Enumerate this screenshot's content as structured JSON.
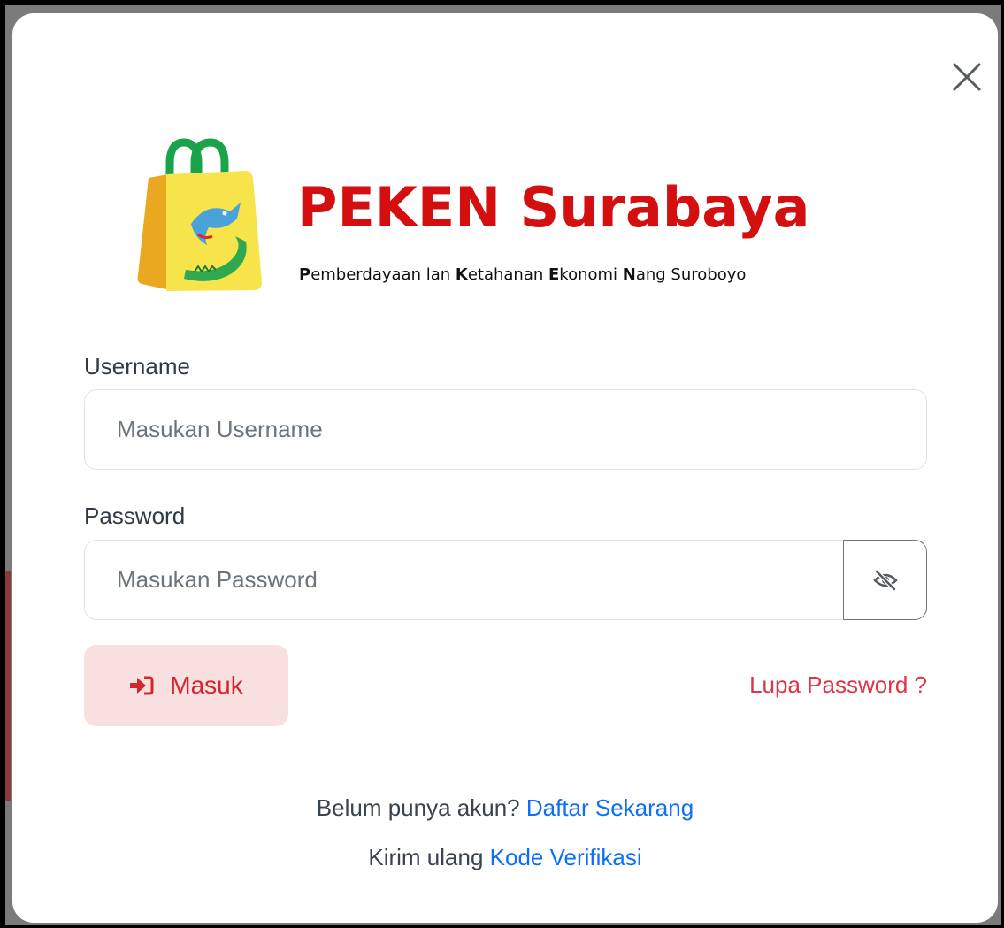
{
  "brand": {
    "title": "PEKEN Surabaya",
    "tagline_parts": [
      {
        "bold": "P",
        "rest": "emberdayaan lan "
      },
      {
        "bold": "K",
        "rest": "etahanan "
      },
      {
        "bold": "E",
        "rest": "konomi "
      },
      {
        "bold": "N",
        "rest": "ang Suroboyo"
      }
    ],
    "title_color": "#d30f0f"
  },
  "form": {
    "username_label": "Username",
    "username_placeholder": "Masukan Username",
    "username_value": "",
    "password_label": "Password",
    "password_placeholder": "Masukan Password",
    "password_value": "",
    "toggle_icon": "eye-slash-icon"
  },
  "actions": {
    "login_label": "Masuk",
    "login_icon": "sign-in-icon",
    "forgot_label": "Lupa Password ?"
  },
  "footer": {
    "register_prompt": "Belum punya akun?",
    "register_link": "Daftar Sekarang",
    "resend_prompt": "Kirim ulang",
    "resend_link": "Kode Verifikasi"
  },
  "colors": {
    "accent_red": "#dc3545",
    "link_blue": "#0d6efd",
    "login_bg": "#f8e0e0"
  },
  "close_icon": "close-icon"
}
